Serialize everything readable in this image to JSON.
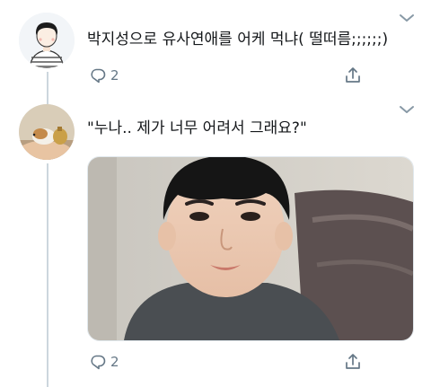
{
  "tweets": [
    {
      "text": "박지성으로 유사연애를 어케 먹냐( 떨떠름;;;;;;)",
      "reply_count": "2",
      "icons": {
        "reply": "reply-icon",
        "share": "share-icon",
        "menu": "chevron-down-icon"
      }
    },
    {
      "text": "\"누나.. 제가 너무 어려서 그래요?\"",
      "reply_count": "2",
      "icons": {
        "reply": "reply-icon",
        "share": "share-icon",
        "menu": "chevron-down-icon"
      }
    }
  ],
  "colors": {
    "text": "#14171a",
    "muted": "#657786",
    "thread_line": "#ccd6dd"
  }
}
